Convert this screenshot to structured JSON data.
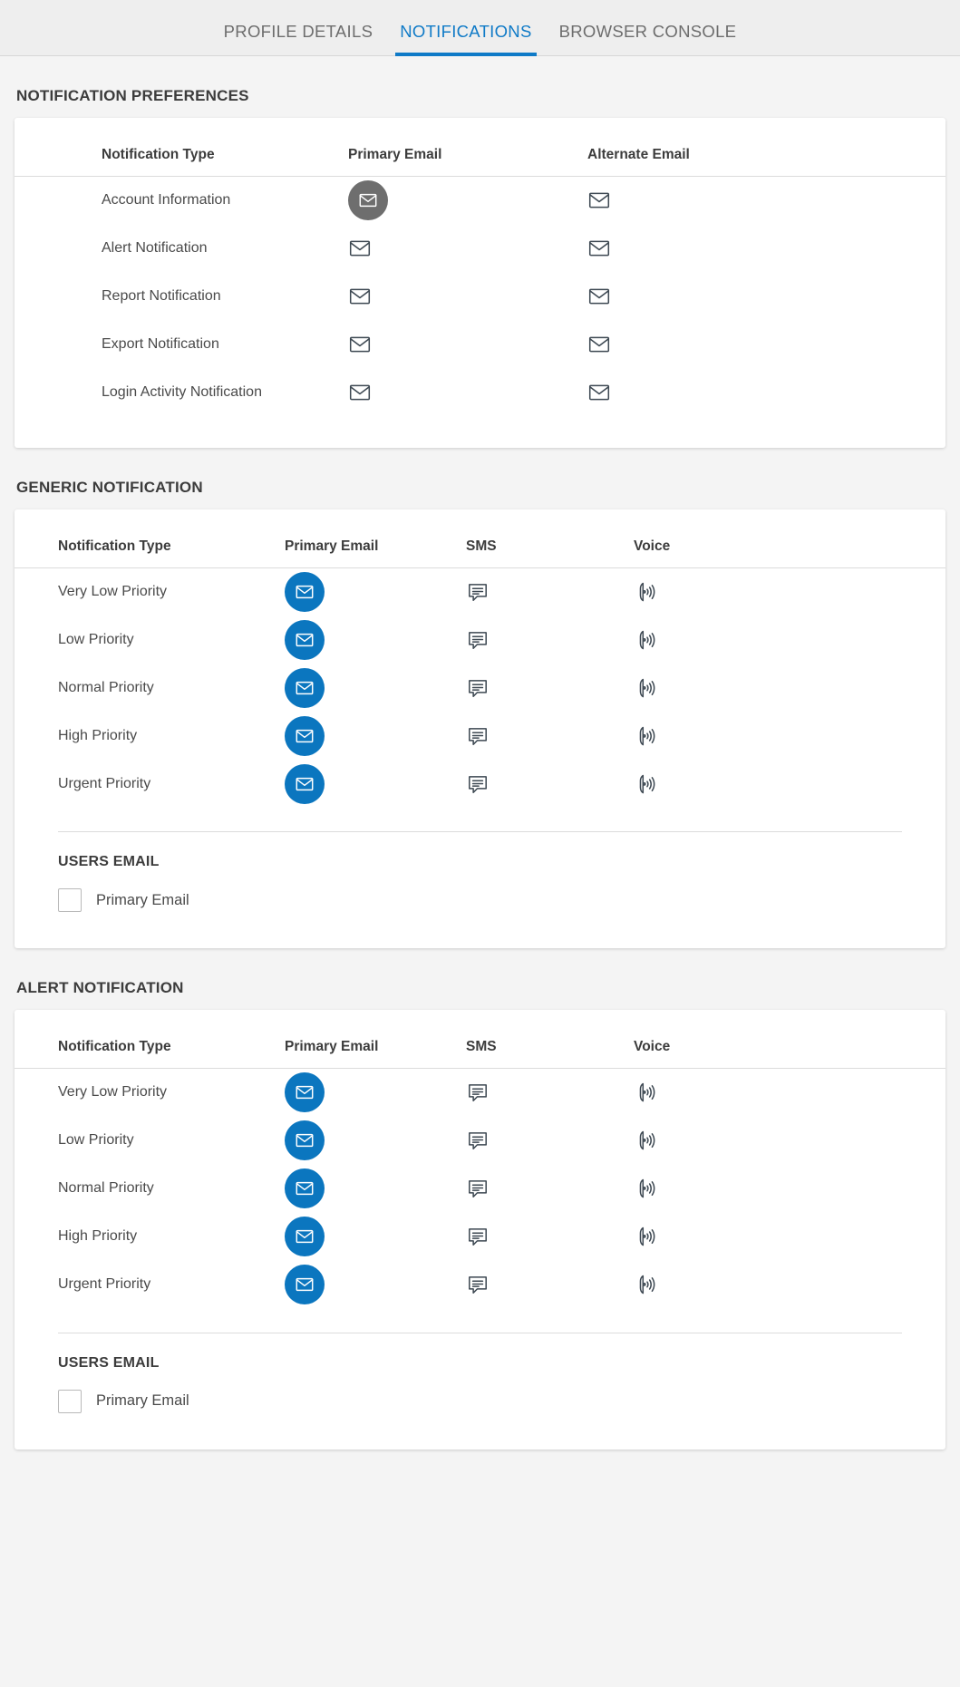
{
  "tabs": [
    {
      "label": "PROFILE DETAILS",
      "active": false
    },
    {
      "label": "NOTIFICATIONS",
      "active": true
    },
    {
      "label": "BROWSER CONSOLE",
      "active": false
    }
  ],
  "colors": {
    "accent": "#0f7ac7",
    "icon_active": "#0b76bf",
    "icon_hover_circle": "#6e6e6e",
    "page_bg": "#f4f4f4",
    "card_bg": "#ffffff",
    "text": "#4a4a4a",
    "heading": "#3c3c3c"
  },
  "sections": [
    {
      "title": "NOTIFICATION PREFERENCES",
      "columns": [
        "Notification Type",
        "Primary Email",
        "Alternate Email"
      ],
      "rows": [
        {
          "type": "Account Information",
          "primary_email": "envelope-icon",
          "primary_state": "hover",
          "alternate_email": "envelope-icon",
          "alternate_state": "default"
        },
        {
          "type": "Alert Notification",
          "primary_email": "envelope-icon",
          "primary_state": "default",
          "alternate_email": "envelope-icon",
          "alternate_state": "default"
        },
        {
          "type": "Report Notification",
          "primary_email": "envelope-icon",
          "primary_state": "default",
          "alternate_email": "envelope-icon",
          "alternate_state": "default"
        },
        {
          "type": "Export Notification",
          "primary_email": "envelope-icon",
          "primary_state": "default",
          "alternate_email": "envelope-icon",
          "alternate_state": "default"
        },
        {
          "type": "Login Activity Notification",
          "primary_email": "envelope-icon",
          "primary_state": "default",
          "alternate_email": "envelope-icon",
          "alternate_state": "default"
        }
      ]
    },
    {
      "title": "GENERIC NOTIFICATION",
      "columns": [
        "Notification Type",
        "Primary Email",
        "SMS",
        "Voice"
      ],
      "rows": [
        {
          "type": "Very Low Priority",
          "primary_email": "envelope-icon",
          "primary_state": "on",
          "sms": "sms-icon",
          "sms_state": "off",
          "voice": "voice-icon",
          "voice_state": "off"
        },
        {
          "type": "Low Priority",
          "primary_email": "envelope-icon",
          "primary_state": "on",
          "sms": "sms-icon",
          "sms_state": "off",
          "voice": "voice-icon",
          "voice_state": "off"
        },
        {
          "type": "Normal Priority",
          "primary_email": "envelope-icon",
          "primary_state": "on",
          "sms": "sms-icon",
          "sms_state": "off",
          "voice": "voice-icon",
          "voice_state": "off"
        },
        {
          "type": "High Priority",
          "primary_email": "envelope-icon",
          "primary_state": "on",
          "sms": "sms-icon",
          "sms_state": "off",
          "voice": "voice-icon",
          "voice_state": "off"
        },
        {
          "type": "Urgent Priority",
          "primary_email": "envelope-icon",
          "primary_state": "on",
          "sms": "sms-icon",
          "sms_state": "off",
          "voice": "voice-icon",
          "voice_state": "off"
        }
      ],
      "users_email": {
        "title": "USERS EMAIL",
        "checkbox_label": "Primary Email",
        "checked": false
      }
    },
    {
      "title": "ALERT NOTIFICATION",
      "columns": [
        "Notification Type",
        "Primary Email",
        "SMS",
        "Voice"
      ],
      "rows": [
        {
          "type": "Very Low Priority",
          "primary_email": "envelope-icon",
          "primary_state": "on",
          "sms": "sms-icon",
          "sms_state": "off",
          "voice": "voice-icon",
          "voice_state": "off"
        },
        {
          "type": "Low Priority",
          "primary_email": "envelope-icon",
          "primary_state": "on",
          "sms": "sms-icon",
          "sms_state": "off",
          "voice": "voice-icon",
          "voice_state": "off"
        },
        {
          "type": "Normal Priority",
          "primary_email": "envelope-icon",
          "primary_state": "on",
          "sms": "sms-icon",
          "sms_state": "off",
          "voice": "voice-icon",
          "voice_state": "off"
        },
        {
          "type": "High Priority",
          "primary_email": "envelope-icon",
          "primary_state": "on",
          "sms": "sms-icon",
          "sms_state": "off",
          "voice": "voice-icon",
          "voice_state": "off"
        },
        {
          "type": "Urgent Priority",
          "primary_email": "envelope-icon",
          "primary_state": "on",
          "sms": "sms-icon",
          "sms_state": "off",
          "voice": "voice-icon",
          "voice_state": "off"
        }
      ],
      "users_email": {
        "title": "USERS EMAIL",
        "checkbox_label": "Primary Email",
        "checked": false
      }
    }
  ]
}
